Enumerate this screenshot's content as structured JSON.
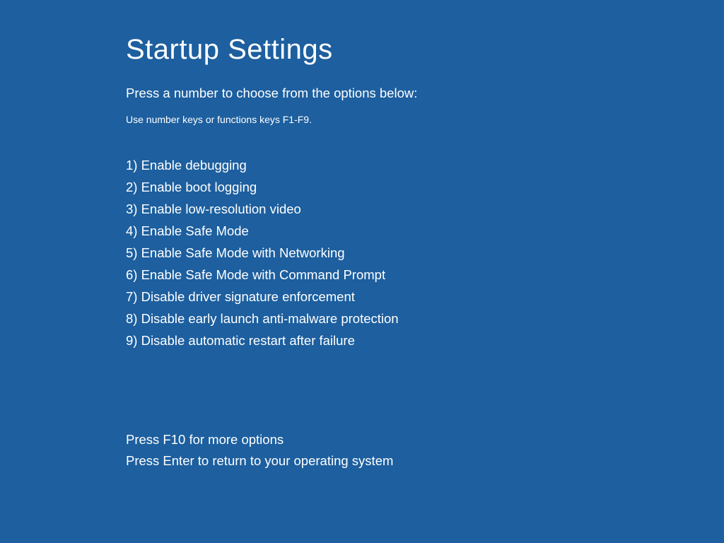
{
  "title": "Startup Settings",
  "instruction": "Press a number to choose from the options below:",
  "hint": "Use number keys or functions keys F1-F9.",
  "options": [
    "1) Enable debugging",
    "2) Enable boot logging",
    "3) Enable low-resolution video",
    "4) Enable Safe Mode",
    "5) Enable Safe Mode with Networking",
    "6) Enable Safe Mode with Command Prompt",
    "7) Disable driver signature enforcement",
    "8) Disable early launch anti-malware protection",
    "9) Disable automatic restart after failure"
  ],
  "footer": {
    "more_options": "Press F10 for more options",
    "return": "Press Enter to return to your operating system"
  }
}
